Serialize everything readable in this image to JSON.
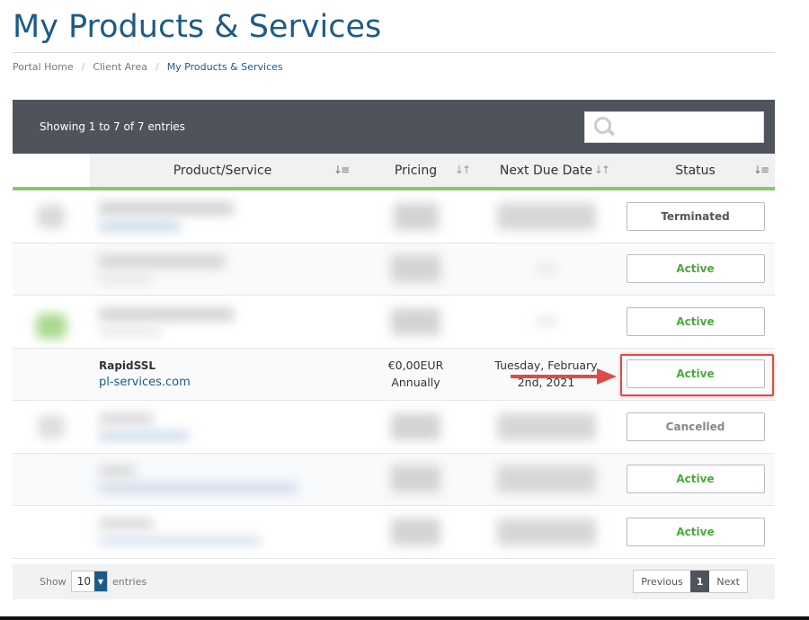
{
  "page": {
    "title": "My Products & Services"
  },
  "breadcrumb": [
    {
      "label": "Portal Home"
    },
    {
      "label": "Client Area"
    },
    {
      "label": "My Products & Services"
    }
  ],
  "table": {
    "showing": "Showing 1 to 7 of 7 entries",
    "search_placeholder": "",
    "columns": {
      "product": "Product/Service",
      "pricing": "Pricing",
      "due": "Next Due Date",
      "status": "Status"
    },
    "rows": [
      {
        "product": "",
        "domain": "",
        "price": "",
        "cycle": "",
        "due": "",
        "status": "Terminated",
        "blurred": true
      },
      {
        "product": "",
        "domain": "",
        "price": "",
        "cycle": "",
        "due": "",
        "status": "Active",
        "blurred": true
      },
      {
        "product": "",
        "domain": "",
        "price": "",
        "cycle": "",
        "due": "",
        "status": "Active",
        "blurred": true
      },
      {
        "product": "RapidSSL",
        "domain": "pl-services.com",
        "price": "€0,00EUR",
        "cycle": "Annually",
        "due_line1": "Tuesday, February",
        "due_line2": "2nd, 2021",
        "status": "Active",
        "blurred": false
      },
      {
        "product": "",
        "domain": "",
        "price": "",
        "cycle": "",
        "due": "",
        "status": "Cancelled",
        "blurred": true
      },
      {
        "product": "",
        "domain": "",
        "price": "",
        "cycle": "",
        "due": "",
        "status": "Active",
        "blurred": true
      },
      {
        "product": "",
        "domain": "",
        "price": "",
        "cycle": "",
        "due": "",
        "status": "Active",
        "blurred": true
      }
    ],
    "footer": {
      "show_label": "Show",
      "entries_value": "10",
      "entries_label": "entries",
      "previous": "Previous",
      "current_page": "1",
      "next": "Next"
    }
  },
  "colors": {
    "title": "#1d5b87",
    "header_bar": "#4f545c",
    "accent_green": "#8dc56c",
    "active_text": "#4aaa3c",
    "highlight": "#e04b45"
  }
}
